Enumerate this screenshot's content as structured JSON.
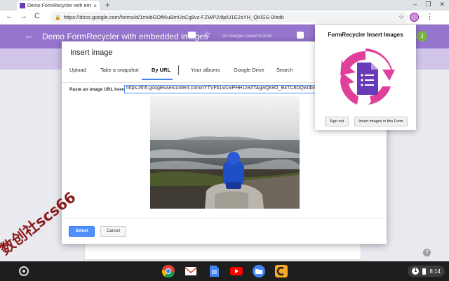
{
  "browser": {
    "tab_title": "Demo FormRecycler with embe",
    "tab_close": "×",
    "new_tab": "+",
    "window_controls": [
      "–",
      "❐",
      "✕"
    ],
    "nav": {
      "back": "←",
      "forward": "→",
      "reload": "C"
    },
    "url": "https://docs.google.com/forms/d/1mxbGOffAuBmUoCg8vz-FZWP24lplU1E2sYH_QKlSS-0/edit",
    "star": "☆",
    "menu": "⋮"
  },
  "forms_header": {
    "back": "←",
    "title": "Demo FormRecycler with embedded images",
    "star": "☆",
    "saved_status": "All changes saved in Drive",
    "avatar_initial": "J"
  },
  "dialog": {
    "title": "Insert image",
    "tabs": [
      "Upload",
      "Take a snapshot",
      "By URL",
      "Your albums",
      "Google Drive",
      "Search"
    ],
    "active_tab": "By URL",
    "url_label": "Paste an image URL here:",
    "url_value": "https://lh5.googleusercontent.com/nYTVFb1w1wPHH1zeZTAgwQk9O_B4TC8DQw0bv_VYsd",
    "select_button": "Select",
    "cancel_button": "Cancel"
  },
  "extension_popup": {
    "title": "FormRecycler Insert Images",
    "sign_out_button": "Sign out",
    "insert_button": "Insert images in this Form"
  },
  "watermark": "数创社scs66",
  "help_icon": "?",
  "shelf": {
    "apps": [
      "chrome",
      "gmail",
      "docs",
      "youtube",
      "files",
      "clipchamp"
    ],
    "notification_count": "1",
    "time": "8:14"
  },
  "colors": {
    "forms_purple": "#9575cd",
    "forms_purple_light": "#d1c4e9",
    "select_blue": "#4d90fe",
    "logo_magenta": "#e1409a",
    "logo_doc_purple": "#673ab7"
  }
}
